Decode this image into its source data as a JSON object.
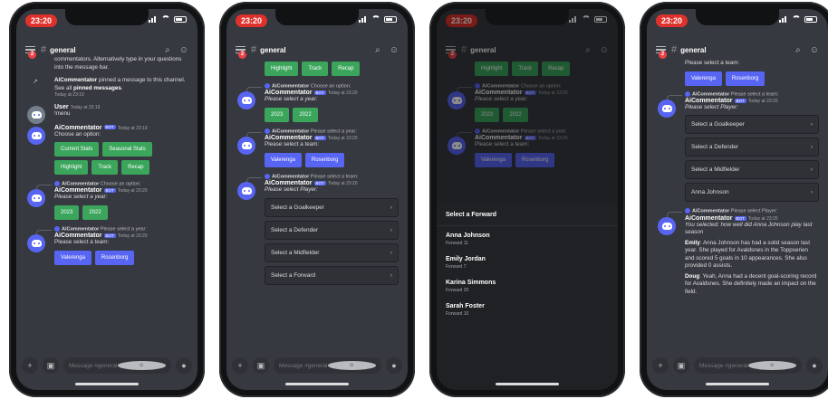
{
  "status_time": "23:20",
  "channel": {
    "name": "general",
    "hash": "#"
  },
  "composer": {
    "placeholder": "Message #general"
  },
  "bot_name": "AiCommentator",
  "bot_tag": "BOT",
  "phone1": {
    "intro": "commentators. Alternatively type in your questions into the message bar.",
    "pin_text_1": "AiCommentator",
    "pin_text_2": "pinned a message to this channel. See all",
    "pin_link": "pinned messages",
    "pin_text_3": ".",
    "pin_time": "Today at 23:19",
    "user_name": "User",
    "user_time": "Today at 23:19",
    "user_msg": "!menu",
    "m1_time": "Today at 23:19",
    "m1_text": "Choose an option:",
    "m1_buttons": [
      "Current Stats",
      "Seasonal Stats",
      "Highlight",
      "Track",
      "Recap"
    ],
    "r2": "Choose an option:",
    "m2_time": "Today at 23:20",
    "m2_text": "Please select a year:",
    "m2_buttons": [
      "2023",
      "2022"
    ],
    "r3": "Please select a year:",
    "m3_time": "Today at 23:20",
    "m3_text": "Please select a team:",
    "m3_buttons": [
      "Valerenga",
      "Rosenborg"
    ]
  },
  "phone2": {
    "top_buttons": [
      "Highlight",
      "Track",
      "Recap"
    ],
    "r1": "Choose an option:",
    "m1_time": "Today at 23:20",
    "m1_text": "Please select a year:",
    "m1_buttons": [
      "2023",
      "2022"
    ],
    "r2": "Please select a year:",
    "m2_time": "Today at 23:20",
    "m2_text": "Please select a team:",
    "m2_buttons": [
      "Valerenga",
      "Rosenborg"
    ],
    "r3": "Please select a team:",
    "m3_time": "Today at 23:20",
    "m3_text": "Please select Player:",
    "selects": [
      "Select a Goalkeeper",
      "Select a Defender",
      "Select a Midfielder",
      "Select a Forward"
    ]
  },
  "phone3": {
    "sheet_title": "Select a Forward",
    "options": [
      {
        "name": "Anna Johnson",
        "desc": "Forward 11"
      },
      {
        "name": "Emily Jordan",
        "desc": "Forward 7"
      },
      {
        "name": "Karina Simmons",
        "desc": "Forward 20"
      },
      {
        "name": "Sarah Foster",
        "desc": "Forward 10"
      }
    ]
  },
  "phone4": {
    "top_text": "Please select a team:",
    "top_buttons": [
      "Valerenga",
      "Rosenborg"
    ],
    "r1": "Please select a team:",
    "m1_time": "Today at 23:20",
    "m1_text": "Please select Player:",
    "selects": [
      "Select a Goalkeeper",
      "Select a Defender",
      "Select a Midfielder",
      "Anna Johnson"
    ],
    "r2": "Please select Player:",
    "m2_time": "Today at 23:20",
    "m2_text": "You selected: how well did Anna Johnson play last season",
    "emily_name": "Emily",
    "emily_text": ": Anna Johnson has had a solid season last year. She played for Avaldsnes in the Toppserien and scored 5 goals in 10 appearances. She also provided 0 assists.",
    "doug_name": "Doug",
    "doug_text": ": Yeah, Anna had a decent goal-scoring record for Avaldsnes. She definitely made an impact on the field."
  }
}
